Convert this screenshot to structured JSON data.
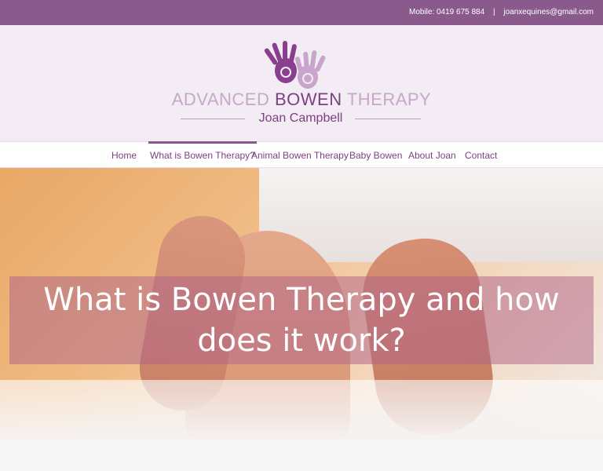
{
  "topbar": {
    "mobile": "Mobile: 0419 675 884",
    "separator": "|",
    "email": "joanxequines@gmail.com"
  },
  "logo": {
    "title_light_1": "ADVANCED ",
    "title_strong": "BOWEN",
    "title_light_2": " THERAPY",
    "subtitle": "Joan Campbell"
  },
  "nav": {
    "items": [
      {
        "label": "Home"
      },
      {
        "label": "What is Bowen Therapy?",
        "active": true
      },
      {
        "label": "Animal Bowen Therapy"
      },
      {
        "label": "Baby Bowen"
      },
      {
        "label": "About Joan"
      },
      {
        "label": "Contact"
      }
    ]
  },
  "hero": {
    "title": "What is Bowen Therapy and how does it work?"
  },
  "colors": {
    "brand_purple": "#8a5a8c",
    "text_purple": "#7e3f82",
    "light_purple": "#c6a8c9"
  }
}
